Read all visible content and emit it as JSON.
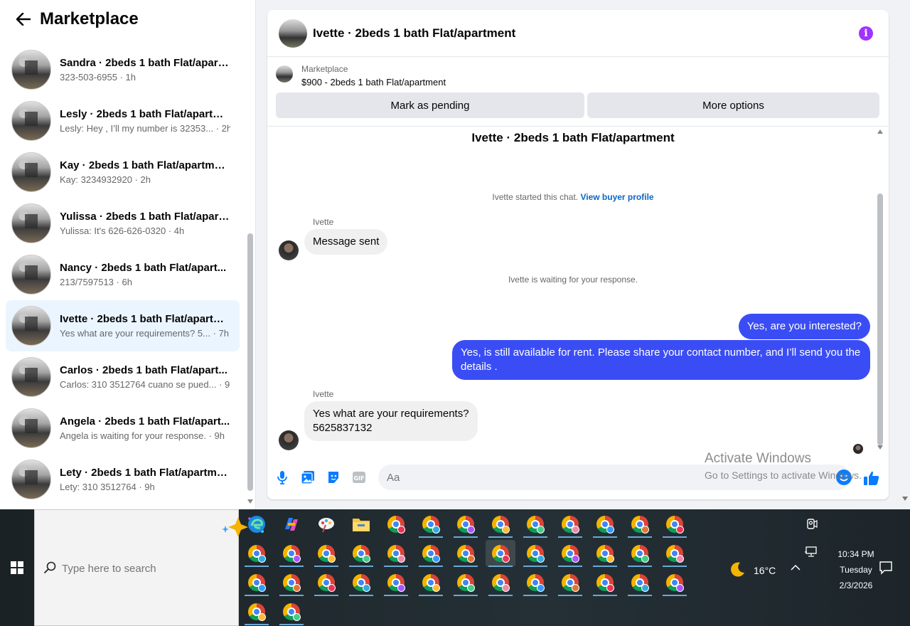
{
  "sidebar": {
    "title": "Marketplace",
    "conversations": [
      {
        "name": "",
        "preview": ""
      },
      {
        "name": "Sandra · 2beds 1 bath Flat/apart...",
        "preview": "323-503-6955 · 1h"
      },
      {
        "name": "Lesly · 2beds 1 bath Flat/apartm...",
        "preview": "Lesly: Hey , I’ll my number is 32353... · 2h"
      },
      {
        "name": "Kay · 2beds 1 bath Flat/apartment",
        "preview": "Kay: 3234932920 · 2h"
      },
      {
        "name": "Yulissa · 2beds 1 bath Flat/apart...",
        "preview": "Yulissa: It's 626-626-0320 · 4h"
      },
      {
        "name": "Nancy · 2beds 1 bath Flat/apart...",
        "preview": "213/7597513 · 6h"
      },
      {
        "name": "Ivette · 2beds 1 bath Flat/apartm...",
        "preview": "Yes what are your requirements? 5...  · 7h",
        "active": true
      },
      {
        "name": "Carlos · 2beds 1 bath Flat/apart...",
        "preview": "Carlos: 310 3512764 cuano se pued... · 9h"
      },
      {
        "name": "Angela · 2beds 1 bath Flat/apart...",
        "preview": "Angela is waiting for your response. · 9h"
      },
      {
        "name": "Lety · 2beds 1 bath Flat/apartment",
        "preview": "Lety: 310 3512764 · 9h"
      }
    ]
  },
  "chat": {
    "title": "Ivette · 2beds 1 bath Flat/apartment",
    "listing": {
      "source": "Marketplace",
      "price_title": "$900 - 2beds 1 bath Flat/apartment",
      "pending_label": "Mark as pending",
      "more_label": "More options"
    },
    "heading": "Ivette · 2beds 1 bath Flat/apartment",
    "started_text": "Ivette started this chat. ",
    "view_profile": "View buyer profile",
    "sender1": "Ivette",
    "msg1": "Message sent",
    "waiting_text": "Ivette is waiting for your response.",
    "out1": "Yes, are you interested?",
    "out2_line1": "Yes, is still available for rent. Please share your contact number, and I’ll send you the",
    "out2_line2": "details .",
    "sender2": "Ivette",
    "msg2_line1": "Yes what are your requirements?",
    "msg2_line2": "5625837132",
    "input_placeholder": "Aa"
  },
  "watermark": {
    "line1": "Activate Windows",
    "line2": "Go to Settings to activate Windows."
  },
  "taskbar": {
    "search_placeholder": "Type here to search",
    "temperature": "16°C",
    "time": "10:34 PM",
    "day": "Tuesday",
    "date": "2/3/2026"
  },
  "colors": {
    "accent": "#3a4df5",
    "link": "#0a66c2",
    "active_row": "#ebf5ff",
    "info_icon": "#a033ff"
  }
}
